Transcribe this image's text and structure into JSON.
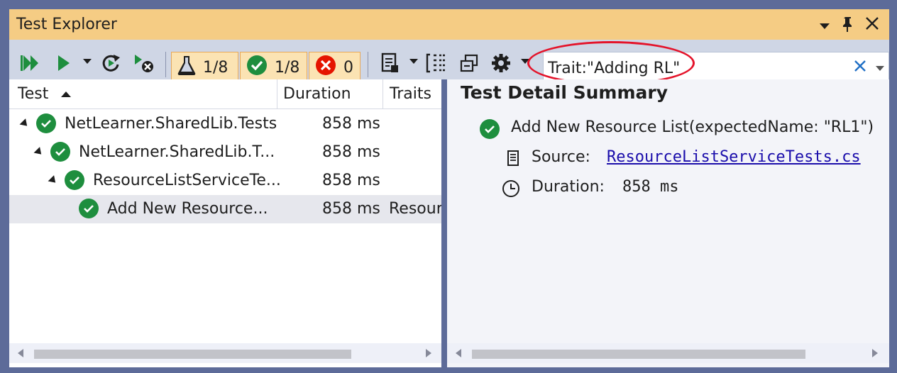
{
  "window": {
    "title": "Test Explorer",
    "controls": [
      "chevron-down",
      "pin",
      "close"
    ]
  },
  "toolbar": {
    "buttons": [
      "run-all-icon",
      "run-icon",
      "rerun-icon",
      "cancel-icon"
    ],
    "counts": {
      "total": "1/8",
      "passed": "1/8",
      "failed": "0"
    },
    "search": {
      "value": "Trait:\"Adding RL\"",
      "placeholder": ""
    }
  },
  "columns": {
    "test": "Test",
    "duration": "Duration",
    "traits": "Traits"
  },
  "rows": [
    {
      "name": "NetLearner.SharedLib.Tests",
      "duration": "858 ms",
      "traits": ""
    },
    {
      "name": "NetLearner.SharedLib.T...",
      "duration": "858 ms",
      "traits": ""
    },
    {
      "name": "ResourceListServiceTe...",
      "duration": "858 ms",
      "traits": ""
    },
    {
      "name": "Add New Resource...",
      "duration": "858 ms",
      "traits": "Resour"
    }
  ],
  "detail": {
    "title": "Test Detail Summary",
    "test_name": "Add New Resource List(expectedName: \"RL1\")",
    "source_label": "Source:",
    "source_file": "ResourceListServiceTests.cs",
    "duration_label": "Duration:",
    "duration_value": "858 ms"
  },
  "colors": {
    "title_bar": "#f5cc84",
    "pass": "#1e8e3e",
    "fail": "#e51400",
    "highlight": "#e4132a",
    "link": "#1a0dab"
  }
}
